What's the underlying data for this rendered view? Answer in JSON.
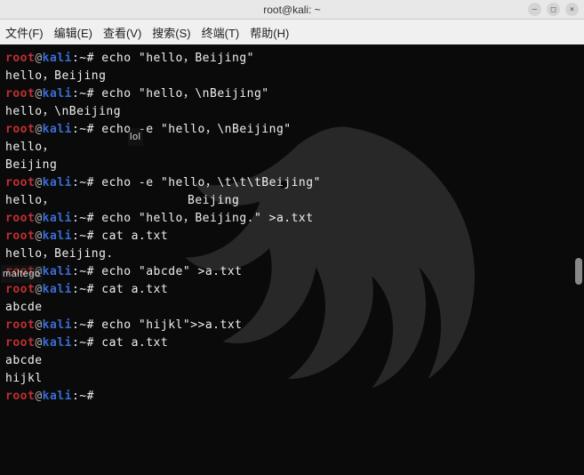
{
  "window": {
    "title": "root@kali: ~",
    "controls": {
      "min": "–",
      "max": "□",
      "close": "×"
    }
  },
  "menu": {
    "file": "文件(F)",
    "edit": "编辑(E)",
    "view": "查看(V)",
    "search": "搜索(S)",
    "terminal": "终端(T)",
    "help": "帮助(H)"
  },
  "prompt": {
    "user": "root",
    "at": "@",
    "host": "kali",
    "path": ":~#"
  },
  "annotations": {
    "lol": "lol",
    "maltego": "maltego"
  },
  "lines": [
    {
      "type": "cmd",
      "text": " echo \"hello，Beijing\""
    },
    {
      "type": "out",
      "text": "hello，Beijing"
    },
    {
      "type": "cmd",
      "text": " echo \"hello，\\nBeijing\""
    },
    {
      "type": "out",
      "text": "hello，\\nBeijing"
    },
    {
      "type": "cmd",
      "text": " echo -e \"hello，\\nBeijing\""
    },
    {
      "type": "out",
      "text": "hello，"
    },
    {
      "type": "out",
      "text": "Beijing"
    },
    {
      "type": "cmd",
      "text": " echo -e \"hello，\\t\\t\\tBeijing\""
    },
    {
      "type": "out",
      "text": "hello，                  Beijing"
    },
    {
      "type": "cmd",
      "text": " echo \"hello，Beijing.\" >a.txt"
    },
    {
      "type": "cmd",
      "text": " cat a.txt"
    },
    {
      "type": "out",
      "text": "hello，Beijing."
    },
    {
      "type": "cmd",
      "text": " echo \"abcde\" >a.txt"
    },
    {
      "type": "cmd",
      "text": " cat a.txt"
    },
    {
      "type": "out",
      "text": "abcde"
    },
    {
      "type": "cmd",
      "text": " echo \"hijkl\">>a.txt"
    },
    {
      "type": "cmd",
      "text": " cat a.txt"
    },
    {
      "type": "out",
      "text": "abcde"
    },
    {
      "type": "out",
      "text": "hijkl"
    },
    {
      "type": "cmd",
      "text": " "
    }
  ]
}
